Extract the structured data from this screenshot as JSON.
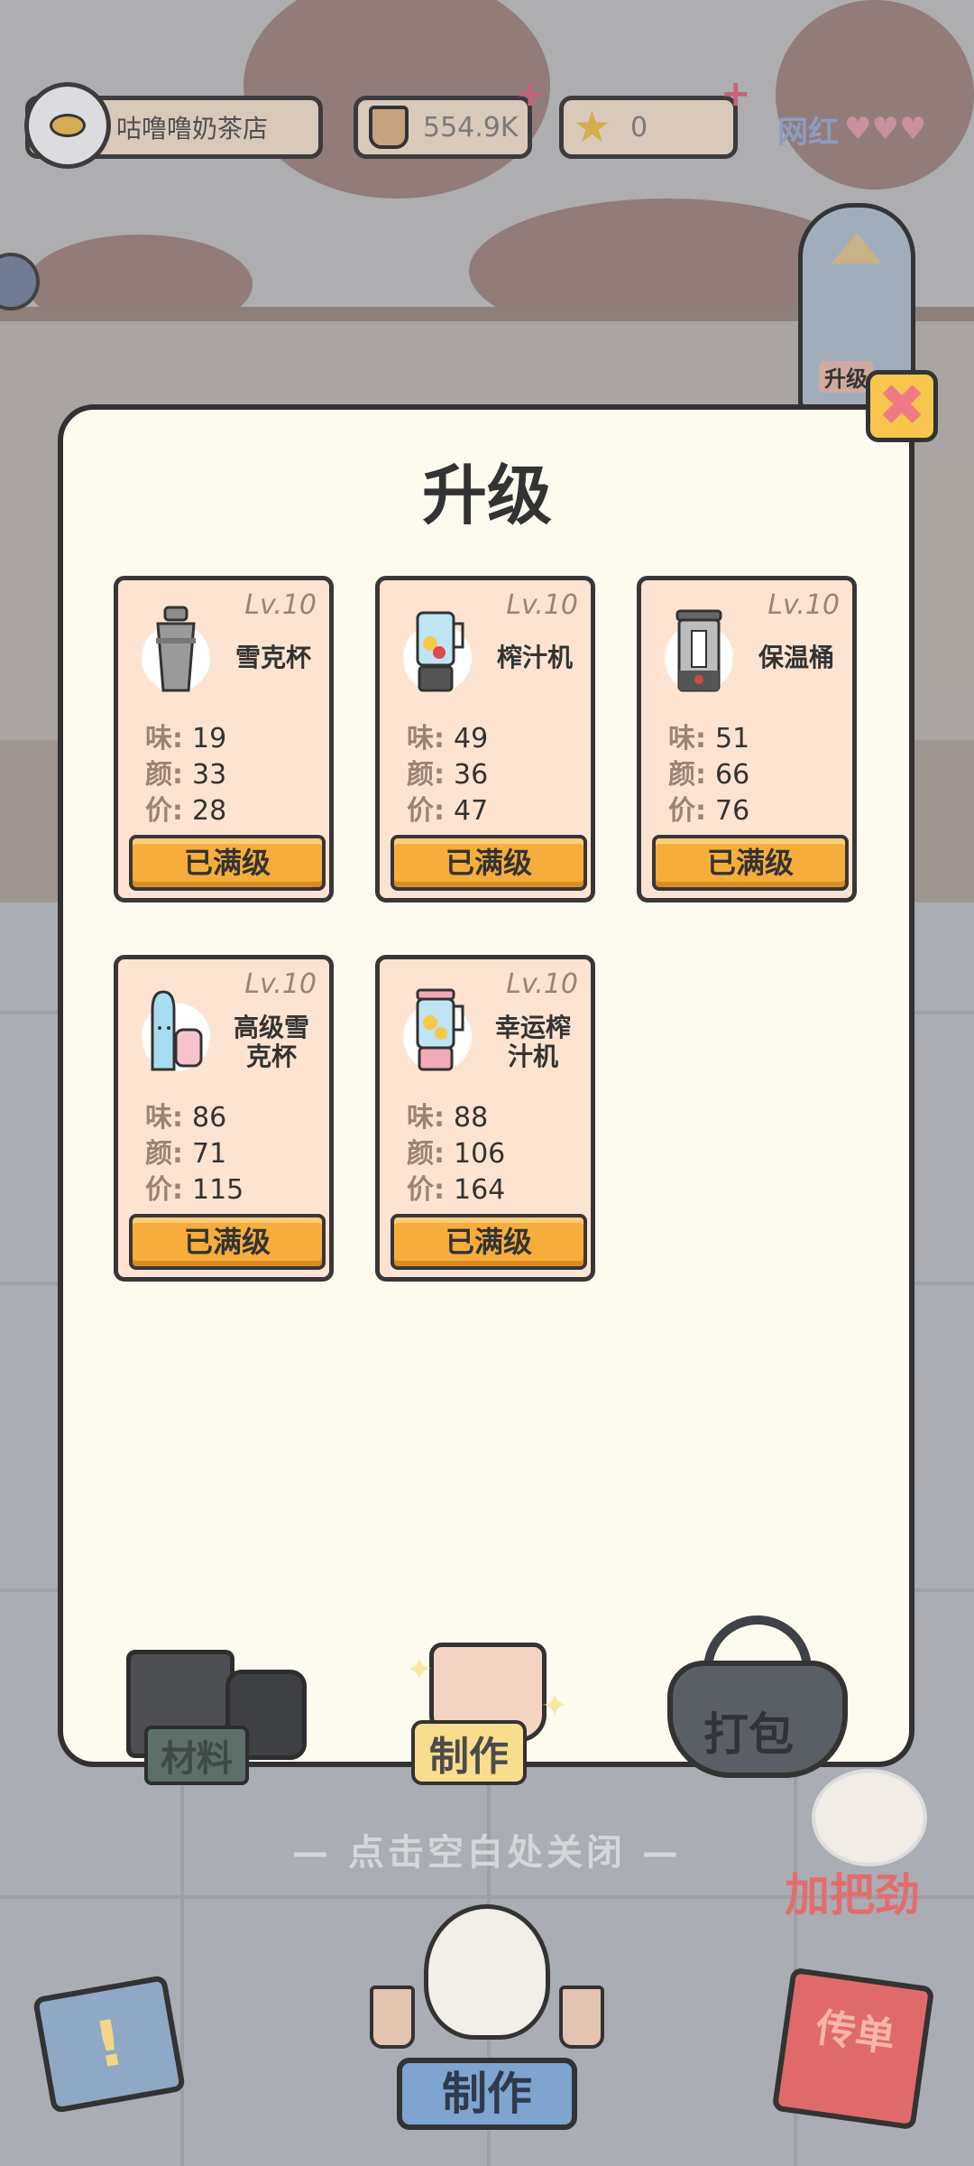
{
  "hud": {
    "shop_name": "咕噜噜奶茶店",
    "currency_value": "554.9K",
    "star_value": "0",
    "popularity_label": "网红"
  },
  "upgrade_side_button": "升级",
  "panel": {
    "title": "升级",
    "items": [
      {
        "name": "雪克杯",
        "level": "Lv.10",
        "taste_label": "味:",
        "taste": "19",
        "color_label": "颜:",
        "color": "33",
        "price_label": "价:",
        "price": "28",
        "button": "已满级",
        "icon": "shaker-icon"
      },
      {
        "name": "榨汁机",
        "level": "Lv.10",
        "taste_label": "味:",
        "taste": "49",
        "color_label": "颜:",
        "color": "36",
        "price_label": "价:",
        "price": "47",
        "button": "已满级",
        "icon": "juicer-icon"
      },
      {
        "name": "保温桶",
        "level": "Lv.10",
        "taste_label": "味:",
        "taste": "51",
        "color_label": "颜:",
        "color": "66",
        "price_label": "价:",
        "price": "76",
        "button": "已满级",
        "icon": "thermos-bucket-icon"
      },
      {
        "name": "高级雪克杯",
        "level": "Lv.10",
        "taste_label": "味:",
        "taste": "86",
        "color_label": "颜:",
        "color": "71",
        "price_label": "价:",
        "price": "115",
        "button": "已满级",
        "icon": "premium-shaker-icon"
      },
      {
        "name": "幸运榨汁机",
        "level": "Lv.10",
        "taste_label": "味:",
        "taste": "88",
        "color_label": "颜:",
        "color": "106",
        "price_label": "价:",
        "price": "164",
        "button": "已满级",
        "icon": "lucky-juicer-icon"
      }
    ]
  },
  "stations": {
    "materials": "材料",
    "make": "制作",
    "pack": "打包"
  },
  "hint": "— 点击空白处关闭 —",
  "cheer": "加把劲",
  "bottom_nav": {
    "make": "制作",
    "flyer": "传单"
  },
  "colors": {
    "accent": "#f6ad3c",
    "card_bg": "#fde4d2",
    "panel_bg": "#fdfbf0",
    "outline": "#3a3638"
  }
}
